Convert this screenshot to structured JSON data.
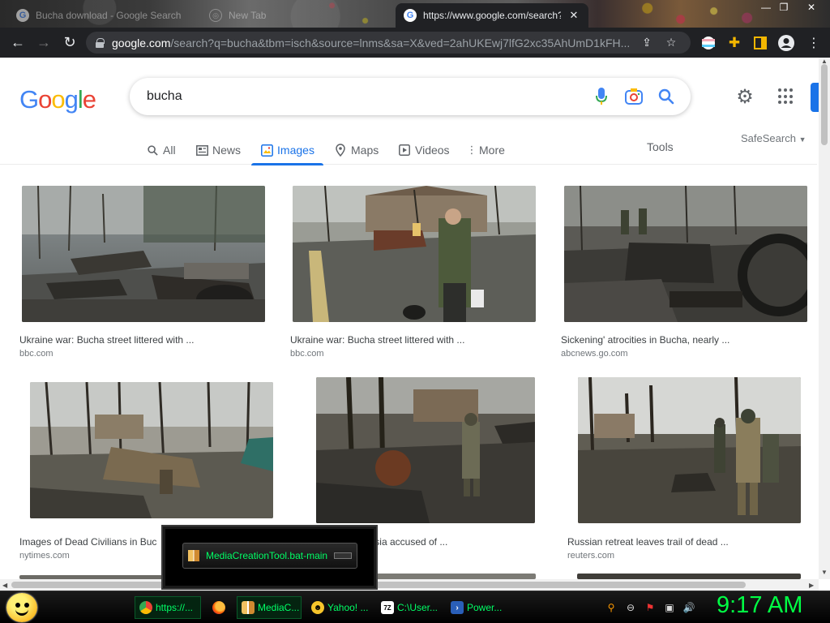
{
  "browser": {
    "tabs": [
      {
        "title": "Bucha download - Google Search",
        "state": "inactive"
      },
      {
        "title": "New Tab",
        "state": "inactive"
      },
      {
        "title": "https://www.google.com/search?q=bucha&tbm",
        "state": "active"
      }
    ],
    "url_host": "google.com",
    "url_path": "/search?q=bucha&tbm=isch&source=lnms&sa=X&ved=2ahUKEwj7lfG2xc35AhUmD1kFH..."
  },
  "google": {
    "logo": "Google",
    "query": "bucha",
    "tabs": [
      "All",
      "News",
      "Images",
      "Maps",
      "Videos",
      "More"
    ],
    "selected_tab": "Images",
    "tools_label": "Tools",
    "safesearch_label": "SafeSearch"
  },
  "results": [
    {
      "title": "Ukraine war: Bucha street littered with ...",
      "source": "bbc.com"
    },
    {
      "title": "Ukraine war: Bucha street littered with ...",
      "source": "bbc.com"
    },
    {
      "title": "Sickening' atrocities in Bucha, nearly ...",
      "source": "abcnews.go.com"
    },
    {
      "title": "Images of Dead Civilians in Buc",
      "source": "nytimes.com"
    },
    {
      "title": "ot': Russia accused of ...",
      "source": ""
    },
    {
      "title": "Russian retreat leaves trail of dead ...",
      "source": "reuters.com"
    }
  ],
  "popup": {
    "label": "MediaCreationTool.bat-main"
  },
  "taskbar": {
    "items": [
      {
        "label": "https://..."
      },
      {
        "label": ""
      },
      {
        "label": "MediaC..."
      },
      {
        "label": "Yahoo! ..."
      },
      {
        "label": "C:\\User..."
      },
      {
        "label": "Power..."
      }
    ],
    "clock": "9:17 AM"
  }
}
